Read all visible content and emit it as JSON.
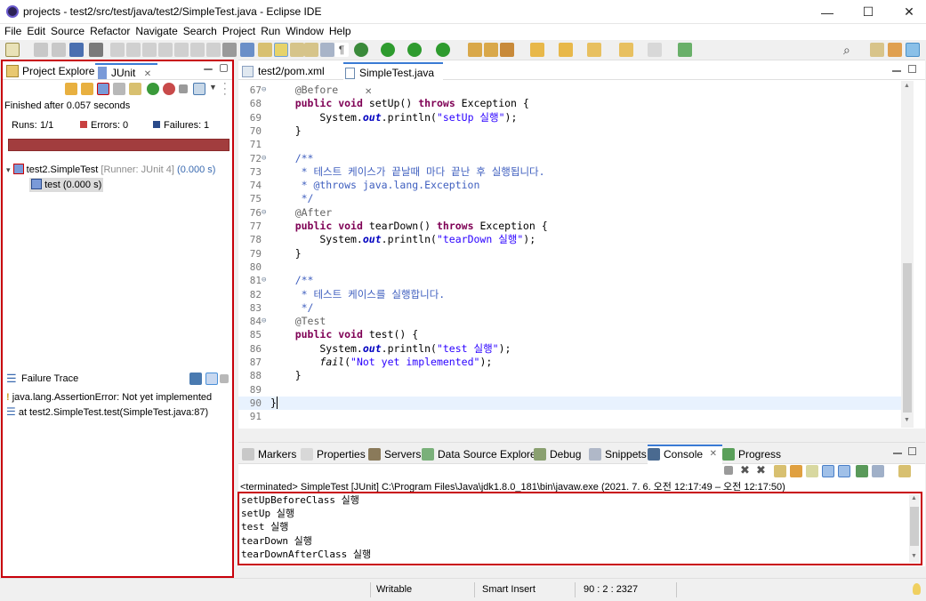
{
  "window": {
    "title": "projects - test2/src/test/java/test2/SimpleTest.java - Eclipse IDE",
    "minimize": "—",
    "maximize": "☐",
    "close": "✕"
  },
  "menu": [
    "File",
    "Edit",
    "Source",
    "Refactor",
    "Navigate",
    "Search",
    "Project",
    "Run",
    "Window",
    "Help"
  ],
  "left_panel": {
    "tabs": [
      {
        "label": "Project Explorer",
        "icon": "folder-icon"
      },
      {
        "label": "JUnit",
        "icon": "junit-icon"
      }
    ],
    "junit_close": "✕",
    "finished": "Finished after 0.057 seconds",
    "runs_label": "Runs:",
    "runs_value": "1/1",
    "errors_label": "Errors:",
    "errors_value": "0",
    "failures_label": "Failures:",
    "failures_value": "1",
    "progress_status": "failed",
    "progress_fraction": 1.0,
    "tree": [
      {
        "name": "test2.SimpleTest",
        "runner": "[Runner: JUnit 4]",
        "time": "(0.000 s)"
      },
      {
        "name": "test (0.000 s)"
      }
    ],
    "failure_trace_title": "Failure Trace",
    "trace": [
      "java.lang.AssertionError: Not yet implemented",
      "at test2.SimpleTest.test(SimpleTest.java:87)"
    ]
  },
  "editor": {
    "tabs": [
      {
        "label": "test2/pom.xml"
      },
      {
        "label": "SimpleTest.java",
        "close": "✕"
      }
    ],
    "lines": [
      {
        "n": "67",
        "fold": "⊖",
        "segs": [
          [
            "ann",
            "    @Before"
          ]
        ]
      },
      {
        "n": "68",
        "segs": [
          [
            "",
            "    "
          ],
          [
            "kw",
            "public"
          ],
          [
            "",
            " "
          ],
          [
            "kw",
            "void"
          ],
          [
            "",
            " setUp() "
          ],
          [
            "kw",
            "throws"
          ],
          [
            "",
            " Exception {"
          ]
        ]
      },
      {
        "n": "69",
        "segs": [
          [
            "",
            "        System."
          ],
          [
            "fld",
            "out"
          ],
          [
            "",
            ".println("
          ],
          [
            "str",
            "\"setUp 실행\""
          ],
          [
            "",
            ");"
          ]
        ]
      },
      {
        "n": "70",
        "segs": [
          [
            "",
            "    }"
          ]
        ]
      },
      {
        "n": "71",
        "segs": [
          [
            "",
            ""
          ]
        ]
      },
      {
        "n": "72",
        "fold": "⊖",
        "segs": [
          [
            "cmt",
            "    /**"
          ]
        ]
      },
      {
        "n": "73",
        "segs": [
          [
            "cmt",
            "     * 테스트 케이스가 끝날때 마다 끝난 후 실행됩니다."
          ]
        ]
      },
      {
        "n": "74",
        "segs": [
          [
            "cmt",
            "     * @throws java.lang.Exception"
          ]
        ]
      },
      {
        "n": "75",
        "segs": [
          [
            "cmt",
            "     */"
          ]
        ]
      },
      {
        "n": "76",
        "fold": "⊖",
        "segs": [
          [
            "ann",
            "    @After"
          ]
        ]
      },
      {
        "n": "77",
        "segs": [
          [
            "",
            "    "
          ],
          [
            "kw",
            "public"
          ],
          [
            "",
            " "
          ],
          [
            "kw",
            "void"
          ],
          [
            "",
            " tearDown() "
          ],
          [
            "kw",
            "throws"
          ],
          [
            "",
            " Exception {"
          ]
        ]
      },
      {
        "n": "78",
        "segs": [
          [
            "",
            "        System."
          ],
          [
            "fld",
            "out"
          ],
          [
            "",
            ".println("
          ],
          [
            "str",
            "\"tearDown 실행\""
          ],
          [
            "",
            ");"
          ]
        ]
      },
      {
        "n": "79",
        "segs": [
          [
            "",
            "    }"
          ]
        ]
      },
      {
        "n": "80",
        "segs": [
          [
            "",
            ""
          ]
        ]
      },
      {
        "n": "81",
        "fold": "⊖",
        "segs": [
          [
            "cmt",
            "    /**"
          ]
        ]
      },
      {
        "n": "82",
        "segs": [
          [
            "cmt",
            "     * 테스트 케이스를 실행합니다."
          ]
        ]
      },
      {
        "n": "83",
        "segs": [
          [
            "cmt",
            "     */"
          ]
        ]
      },
      {
        "n": "84",
        "fold": "⊖",
        "segs": [
          [
            "ann",
            "    @Test"
          ]
        ]
      },
      {
        "n": "85",
        "segs": [
          [
            "",
            "    "
          ],
          [
            "kw",
            "public"
          ],
          [
            "",
            " "
          ],
          [
            "kw",
            "void"
          ],
          [
            "",
            " test() {"
          ]
        ]
      },
      {
        "n": "86",
        "segs": [
          [
            "",
            "        System."
          ],
          [
            "fld",
            "out"
          ],
          [
            "",
            ".println("
          ],
          [
            "str",
            "\"test 실행\""
          ],
          [
            "",
            ");"
          ]
        ]
      },
      {
        "n": "87",
        "segs": [
          [
            "",
            "        "
          ],
          [
            "itl",
            "fail"
          ],
          [
            "",
            "("
          ],
          [
            "str",
            "\"Not yet implemented\""
          ],
          [
            "",
            ");"
          ]
        ]
      },
      {
        "n": "88",
        "segs": [
          [
            "",
            "    }"
          ]
        ]
      },
      {
        "n": "89",
        "segs": [
          [
            "",
            ""
          ]
        ]
      },
      {
        "n": "90",
        "segs": [
          [
            "",
            "}"
          ]
        ],
        "current": true
      },
      {
        "n": "91",
        "segs": [
          [
            "",
            ""
          ]
        ]
      }
    ]
  },
  "bottom": {
    "tabs": [
      {
        "label": "Markers",
        "icon": "markers-icon"
      },
      {
        "label": "Properties",
        "icon": "properties-icon"
      },
      {
        "label": "Servers",
        "icon": "servers-icon"
      },
      {
        "label": "Data Source Explorer",
        "icon": "datasource-icon"
      },
      {
        "label": "Debug",
        "icon": "debug-icon"
      },
      {
        "label": "Snippets",
        "icon": "snippets-icon"
      },
      {
        "label": "Console",
        "icon": "console-icon",
        "active": true
      },
      {
        "label": "Progress",
        "icon": "progress-icon"
      }
    ],
    "console_close": "✕",
    "terminated": "<terminated> SimpleTest [JUnit] C:\\Program Files\\Java\\jdk1.8.0_181\\bin\\javaw.exe  (2021. 7. 6. 오전 12:17:49 – 오전 12:17:50)",
    "output": [
      "setUpBeforeClass 실행",
      "setUp 실행",
      "test 실행",
      "tearDown 실행",
      "tearDownAfterClass 실행"
    ]
  },
  "status": {
    "writable": "Writable",
    "insert": "Smart Insert",
    "position": "90 : 2 : 2327"
  },
  "colors": {
    "failure_bar": "#a23d3e",
    "highlight_border": "#c8000a",
    "keyword": "#7f0055",
    "string": "#2a00ff",
    "comment": "#3f5fbf"
  }
}
